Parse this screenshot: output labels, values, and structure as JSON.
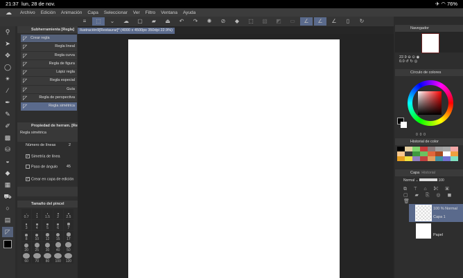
{
  "status": {
    "time": "21:37",
    "date": "lun, 28 de nov.",
    "battery": "76%"
  },
  "menu": [
    "Archivo",
    "Edición",
    "Animación",
    "Capa",
    "Seleccionar",
    "Ver",
    "Filtro",
    "Ventana",
    "Ayuda"
  ],
  "document_tab": "Ilustración9[Restaurar]* (4000 x 4500px 350dpi 22.9%)",
  "subtool": {
    "title": "Subherramienta [Regla]",
    "items": [
      "Crear regla",
      "Regla lineal",
      "Regla curva",
      "Regla de figura",
      "Lápiz regla",
      "Regla especial",
      "Guía",
      "Regla de perspectiva",
      "Regla simétrica"
    ],
    "selected": 8
  },
  "tool_property": {
    "title": "Propiedad de herram. [Re",
    "tool_name": "Regla simétrica",
    "lines_label": "Número de líneas",
    "lines_value": "2",
    "line_symmetry": "Simetría de línea",
    "angle_step": "Paso de ángulo",
    "angle_value": "45",
    "create_layer": "Crear en capa de edición"
  },
  "brush_size": {
    "title": "Tamaño del pincel",
    "sizes": [
      "0.7",
      "1",
      "1.5",
      "2",
      "2.5",
      "3",
      "4",
      "5",
      "6",
      "7",
      "8",
      "10",
      "12",
      "15",
      "17",
      "20",
      "25",
      "30",
      "40",
      "50",
      "60",
      "70",
      "80",
      "100",
      "120"
    ]
  },
  "navigator": {
    "title": "Navegador",
    "zoom": "22.9",
    "angle": "0.0"
  },
  "color_wheel": {
    "title": "Círculo de colores",
    "values": [
      "0",
      "0",
      "0"
    ]
  },
  "color_history": {
    "title": "Historial de color",
    "colors": [
      "#000000",
      "#e6cfa0",
      "#7dd36d",
      "#c83c3c",
      "#8a7a7a",
      "#a0a0a0",
      "#a8a8a8",
      "#f4a8a8",
      "#f8c890",
      "#3a3a3a",
      "#3f9a3f",
      "#6cc060",
      "#e0663a",
      "#a84a20",
      "#ffffff",
      "#f0a040",
      "#e8a020",
      "#f0e040",
      "#9080c0",
      "#c04040",
      "#e0a060",
      "#4090a0",
      "#7070d0",
      "#80e0c0"
    ]
  },
  "layers": {
    "tabs": [
      "Capa",
      "Historial"
    ],
    "blend": "Normal",
    "opacity": "100",
    "items": [
      {
        "mode": "100 % Normal",
        "name": "Capa 1"
      },
      {
        "mode": "",
        "name": "Papel"
      }
    ]
  }
}
